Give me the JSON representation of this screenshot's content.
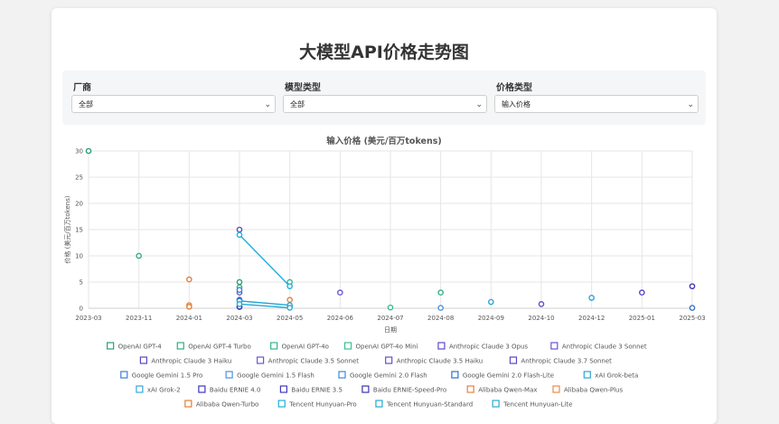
{
  "page": {
    "title": "大模型API价格走势图"
  },
  "filters": [
    {
      "label": "厂商",
      "value": "全部"
    },
    {
      "label": "模型类型",
      "value": "全部"
    },
    {
      "label": "价格类型",
      "value": "输入价格"
    }
  ],
  "chart_data": {
    "type": "scatter",
    "title": "输入价格 (美元/百万tokens)",
    "xlabel": "日期",
    "ylabel": "价格 (美元/百万tokens)",
    "ylim": [
      0,
      30
    ],
    "yticks": [
      0,
      5,
      10,
      15,
      20,
      25,
      30
    ],
    "xticks": [
      "2023-03",
      "2023-11",
      "2024-01",
      "2024-03",
      "2024-05",
      "2024-06",
      "2024-07",
      "2024-08",
      "2024-09",
      "2024-10",
      "2024-12",
      "2025-01",
      "2025-03"
    ],
    "grid": true,
    "legend_position": "bottom",
    "series": [
      {
        "name": "OpenAI GPT-4",
        "color": "#27a176",
        "points": [
          [
            "2023-03",
            30
          ],
          [
            "2024-03",
            5
          ]
        ]
      },
      {
        "name": "OpenAI GPT-4 Turbo",
        "color": "#2fae85",
        "points": [
          [
            "2023-11",
            10
          ],
          [
            "2024-03",
            4
          ]
        ]
      },
      {
        "name": "OpenAI GPT-4o",
        "color": "#36b38f",
        "points": [
          [
            "2024-05",
            5
          ],
          [
            "2024-08",
            3
          ]
        ]
      },
      {
        "name": "OpenAI GPT-4o Mini",
        "color": "#3bbd97",
        "points": [
          [
            "2024-07",
            0.15
          ]
        ]
      },
      {
        "name": "Anthropic Claude 3 Opus",
        "color": "#5b49c9",
        "points": [
          [
            "2024-03",
            15
          ]
        ]
      },
      {
        "name": "Anthropic Claude 3 Sonnet",
        "color": "#6a54d1",
        "points": [
          [
            "2024-03",
            3
          ]
        ]
      },
      {
        "name": "Anthropic Claude 3 Haiku",
        "color": "#5a47c2",
        "points": [
          [
            "2024-03",
            0.25
          ]
        ]
      },
      {
        "name": "Anthropic Claude 3.5 Sonnet",
        "color": "#6d55d6",
        "points": [
          [
            "2024-06",
            3
          ]
        ]
      },
      {
        "name": "Anthropic Claude 3.5 Haiku",
        "color": "#6150cc",
        "points": [
          [
            "2024-10",
            0.8
          ]
        ]
      },
      {
        "name": "Anthropic Claude 3.7 Sonnet",
        "color": "#5646c4",
        "points": [
          [
            "2025-01",
            3
          ]
        ]
      },
      {
        "name": "Google Gemini 1.5 Pro",
        "color": "#3a7fd6",
        "points": [
          [
            "2024-03",
            3.5
          ]
        ]
      },
      {
        "name": "Google Gemini 1.5 Flash",
        "color": "#4a90e2",
        "points": [
          [
            "2024-05",
            0.35
          ],
          [
            "2024-08",
            0.075
          ]
        ]
      },
      {
        "name": "Google Gemini 2.0 Flash",
        "color": "#3f89d9",
        "points": [
          [
            "2024-12",
            2
          ]
        ]
      },
      {
        "name": "Google Gemini 2.0 Flash-Lite",
        "color": "#2f6fc7",
        "points": [
          [
            "2025-03",
            0.075
          ]
        ]
      },
      {
        "name": "xAI Grok-beta",
        "color": "#2aa5d6",
        "points": [
          [
            "2024-09",
            1.2
          ]
        ]
      },
      {
        "name": "xAI Grok-2",
        "color": "#33a9d9",
        "points": [
          [
            "2024-12",
            2
          ]
        ]
      },
      {
        "name": "Baidu ERNIE 4.0",
        "color": "#3d34b8",
        "points": [
          [
            "2025-03",
            4.2
          ]
        ]
      },
      {
        "name": "Baidu ERNIE 3.5",
        "color": "#4139bd",
        "points": [
          [
            "2024-03",
            1.6
          ]
        ]
      },
      {
        "name": "Baidu ERNIE-Speed-Pro",
        "color": "#3a32b0",
        "points": [
          [
            "2024-03",
            0.3
          ]
        ]
      },
      {
        "name": "Alibaba Qwen-Max",
        "color": "#e8803b",
        "points": [
          [
            "2024-01",
            5.5
          ],
          [
            "2024-05",
            1.6
          ]
        ]
      },
      {
        "name": "Alibaba Qwen-Plus",
        "color": "#ec8a46",
        "points": [
          [
            "2024-01",
            0.6
          ]
        ]
      },
      {
        "name": "Alibaba Qwen-Turbo",
        "color": "#e37d33",
        "points": [
          [
            "2024-01",
            0.3
          ]
        ]
      },
      {
        "name": "Tencent Hunyuan-Pro",
        "color": "#1fb0d8",
        "points": [
          [
            "2024-03",
            14
          ],
          [
            "2024-05",
            4.2
          ]
        ],
        "line": true
      },
      {
        "name": "Tencent Hunyuan-Standard",
        "color": "#22a8d4",
        "points": [
          [
            "2024-03",
            1.4
          ],
          [
            "2024-05",
            0.6
          ]
        ],
        "line": true
      },
      {
        "name": "Tencent Hunyuan-Lite",
        "color": "#28a9d6",
        "points": [
          [
            "2024-03",
            0.8
          ],
          [
            "2024-05",
            0.1
          ]
        ],
        "line": true
      }
    ]
  }
}
